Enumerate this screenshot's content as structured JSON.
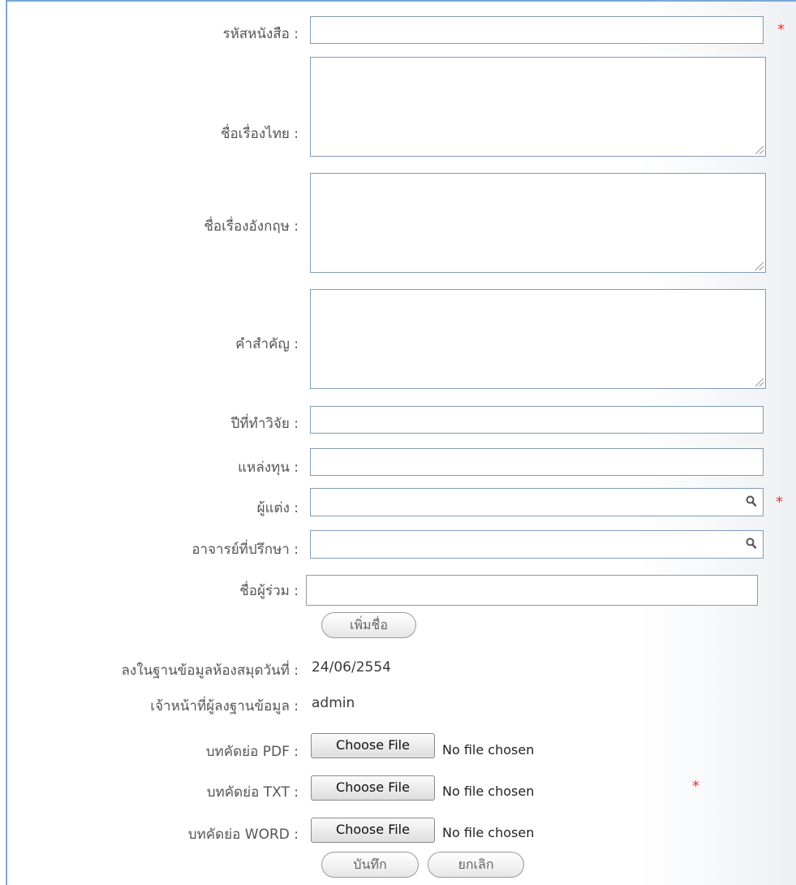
{
  "form": {
    "book_code_label": "รหัสหนังสือ :",
    "thai_title_label": "ชื่อเรื่องไทย :",
    "english_title_label": "ชื่อเรื่องอังกฤษ :",
    "keywords_label": "คำสำคัญ :",
    "research_year_label": "ปีที่ทำวิจัย :",
    "funding_source_label": "แหล่งทุน :",
    "author_label": "ผู้แต่ง :",
    "advisor_label": "อาจารย์ที่ปรึกษา :",
    "co_author_label": "ชื่อผู้ร่วม :",
    "add_name_button": "เพิ่มชื่อ",
    "library_date_label": "ลงในฐานข้อมูลห้องสมุดวันที่ :",
    "library_date_value": "24/06/2554",
    "staff_label": "เจ้าหน้าที่ผู้ลงฐานข้อมูล :",
    "staff_value": "admin",
    "abstract_pdf_label": "บทคัดย่อ PDF :",
    "abstract_txt_label": "บทคัดย่อ TXT :",
    "abstract_word_label": "บทคัดย่อ WORD :",
    "choose_file_label": "Choose File",
    "no_file_text": "No file chosen",
    "save_button": "บันทึก",
    "cancel_button": "ยกเลิก",
    "required_mark": "*"
  },
  "colors": {
    "frame_border": "#7aa7d6",
    "input_border": "#7f9db9",
    "required": "#e8352d"
  },
  "icons": {
    "author_lookup": "search-icon",
    "advisor_lookup": "search-icon"
  }
}
